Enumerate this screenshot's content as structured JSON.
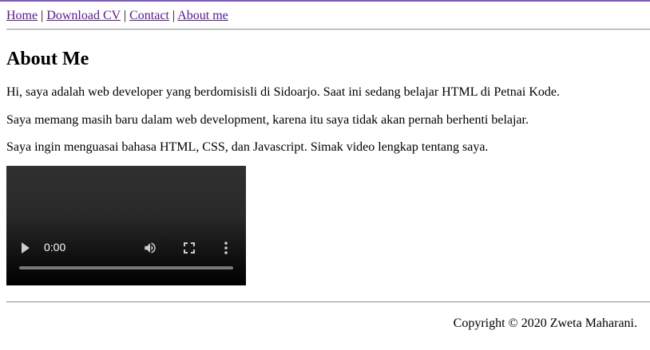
{
  "nav": {
    "items": [
      {
        "label": "Home"
      },
      {
        "label": "Download CV"
      },
      {
        "label": "Contact"
      },
      {
        "label": "About me"
      }
    ],
    "separator": "|"
  },
  "main": {
    "heading": "About Me",
    "paragraphs": [
      "Hi, saya adalah web developer yang berdomisisli di Sidoarjo. Saat ini sedang belajar HTML di Petnai Kode.",
      "Saya memang masih baru dalam web development, karena itu saya tidak akan pernah berhenti belajar.",
      "Saya ingin menguasai bahasa HTML, CSS, dan Javascript. Simak video lengkap tentang saya."
    ],
    "video": {
      "current_time": "0:00",
      "progress": 0
    }
  },
  "footer": {
    "copyright": "Copyright © 2020 Zweta Maharani."
  },
  "colors": {
    "link": "#551a8b",
    "top_border": "#7e57c2"
  }
}
